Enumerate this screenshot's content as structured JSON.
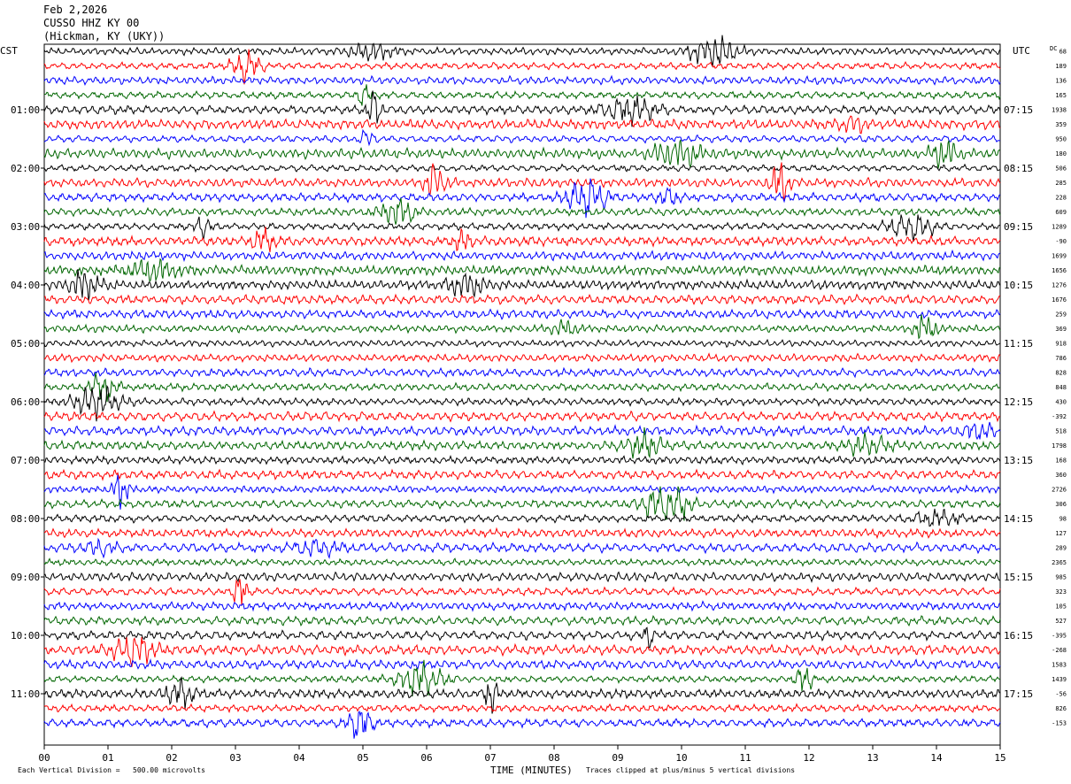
{
  "header": {
    "date": "Feb 2,2026",
    "station": "CUSSO HHZ KY 00",
    "location": "(Hickman, KY (UKY))"
  },
  "chart_data": {
    "type": "line",
    "title": "",
    "left_timezone": "CST",
    "right_timezone": "UTC",
    "dc_label": "DC",
    "xlabel": "TIME (MINUTES)",
    "x_ticks": [
      "00",
      "01",
      "02",
      "03",
      "04",
      "05",
      "06",
      "07",
      "08",
      "09",
      "10",
      "11",
      "12",
      "13",
      "14",
      "15"
    ],
    "xlim": [
      0,
      15
    ],
    "left_time_labels": [
      "01:00",
      "02:00",
      "03:00",
      "04:00",
      "05:00",
      "06:00",
      "07:00",
      "08:00",
      "09:00",
      "10:00",
      "11:00"
    ],
    "right_time_labels": [
      "07:15",
      "08:15",
      "09:15",
      "10:15",
      "11:15",
      "12:15",
      "13:15",
      "14:15",
      "15:15",
      "16:15",
      "17:15"
    ],
    "trace_colors": [
      "#000000",
      "#ff0000",
      "#0000ff",
      "#006600"
    ],
    "dc_offsets": [
      "68",
      "189",
      "136",
      "165",
      "1938",
      "359",
      "950",
      "180",
      "506",
      "285",
      "228",
      "609",
      "1289",
      "-90",
      "1699",
      "1656",
      "1276",
      "1676",
      "259",
      "369",
      "918",
      "786",
      "828",
      "848",
      "430",
      "-392",
      "518",
      "1798",
      "168",
      "360",
      "2726",
      "306",
      "98",
      "127",
      "289",
      "2365",
      "985",
      "323",
      "105",
      "527",
      "-395",
      "-268",
      "1583",
      "1439",
      "-56",
      "826",
      "-153"
    ],
    "num_traces": 47,
    "minutes_per_line": 15,
    "footer": {
      "scale_note": "Each Vertical Division =   500.00 microvolts",
      "clip_note": "Traces clipped at plus/minus 5 vertical divisions"
    }
  }
}
